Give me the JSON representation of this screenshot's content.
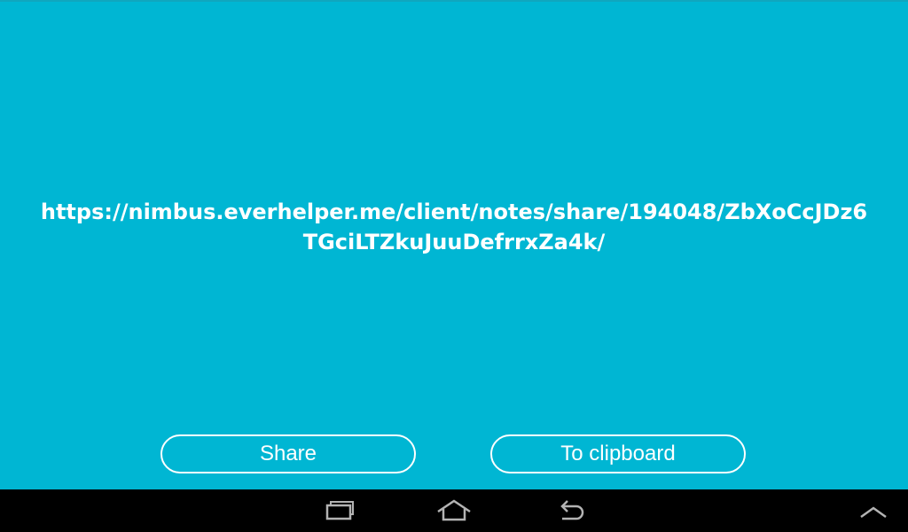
{
  "share_link": {
    "url": "https://nimbus.everhelper.me/client/notes/share/194048/ZbXoCcJDz6TGciLTZkuJuuDefrrxZa4k/"
  },
  "buttons": {
    "share_label": "Share",
    "clipboard_label": "To clipboard"
  },
  "colors": {
    "background": "#00b6d3",
    "text": "#ffffff",
    "navbar": "#000000"
  },
  "navbar": {
    "icons": [
      "recent-apps-icon",
      "home-icon",
      "back-icon",
      "menu-up-icon"
    ]
  }
}
